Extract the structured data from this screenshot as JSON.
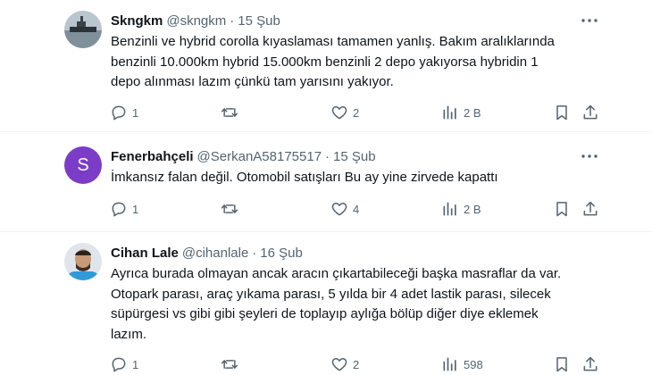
{
  "tweets": [
    {
      "name": "Skngkm",
      "handle": "@skngkm",
      "separator": "·",
      "date": "15 Şub",
      "text": "Benzinli ve hybrid corolla kıyaslaması tamamen yanlış. Bakım aralıklarında\nbenzinli 10.000km hybrid 15.000km benzinli 2 depo yakıyorsa hybridin 1\ndepo alınması lazım çünkü tam yarısını yakıyor.",
      "replies": "1",
      "retweets": "",
      "likes": "2",
      "views": "2 B",
      "avatar": "photo-ship"
    },
    {
      "name": "Fenerbahçeli",
      "handle": "@SerkanA58175517",
      "separator": "·",
      "date": "15 Şub",
      "text": "İmkansız falan değil. Otomobil satışları Bu ay yine zirvede kapattı",
      "replies": "1",
      "retweets": "",
      "likes": "4",
      "views": "2 B",
      "avatar_letter": "S",
      "avatar_color": "#7b3cc7"
    },
    {
      "name": "Cihan Lale",
      "handle": "@cihanlale",
      "separator": "·",
      "date": "16 Şub",
      "text": "Ayrıca burada olmayan ancak aracın çıkartabileceği başka masraflar da var.\nOtopark parası, araç yıkama parası, 5 yılda bir 4 adet lastik parası, silecek\nsüpürgesi vs gibi gibi şeyleri de toplayıp aylığa bölüp diğer diye eklemek\nlazım.",
      "replies": "1",
      "retweets": "",
      "likes": "2",
      "views": "598",
      "avatar": "photo-person"
    }
  ],
  "icons": {
    "reply": "reply-icon",
    "retweet": "retweet-icon",
    "like": "heart-icon",
    "views": "views-icon",
    "bookmark": "bookmark-icon",
    "share": "share-icon",
    "more": "more-icon"
  },
  "colors": {
    "text": "#0f1419",
    "secondary": "#536471",
    "divider": "#eff3f4"
  }
}
